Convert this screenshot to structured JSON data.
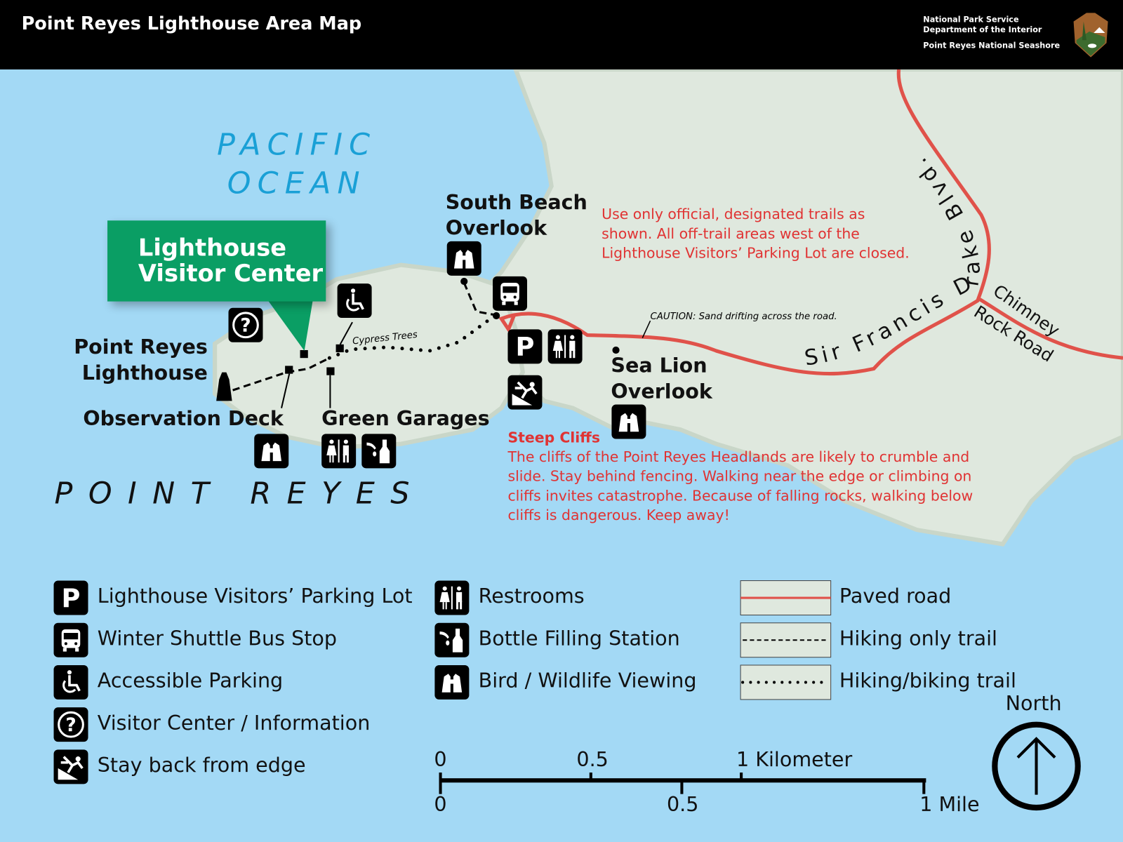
{
  "header": {
    "title": "Point Reyes Lighthouse Area Map",
    "agency_line1": "National Park Service",
    "agency_line2": "Department of the Interior",
    "park": "Point Reyes National Seashore",
    "logo_text": "NATIONAL PARK SERVICE"
  },
  "map": {
    "ocean_label_1": "PACIFIC",
    "ocean_label_2": "OCEAN",
    "point_label": "POINT REYES",
    "visitor_center_1": "Lighthouse",
    "visitor_center_2": "Visitor Center",
    "lighthouse_1": "Point Reyes",
    "lighthouse_2": "Lighthouse",
    "observation_deck": "Observation Deck",
    "green_garages": "Green Garages",
    "south_beach_1": "South Beach",
    "south_beach_2": "Overlook",
    "sea_lion_1": "Sea Lion",
    "sea_lion_2": "Overlook",
    "cypress": "Cypress Trees",
    "caution": "CAUTION: Sand drifting across the road.",
    "road_main": "Sir Francis Drake Blvd.",
    "road_chimney_1": "Chimney",
    "road_chimney_2": "Rock Road",
    "trail_notice": [
      "Use only official, designated trails as",
      "shown. All off-trail areas west of the",
      "Lighthouse Visitors’ Parking Lot are closed."
    ],
    "cliffs_title": "Steep Cliffs",
    "cliffs_text": [
      "The cliffs of the Point Reyes Headlands are likely to crumble and",
      "slide. Stay behind fencing. Walking near the edge or climbing on",
      "cliffs invites catastrophe. Because of falling rocks, walking below",
      "cliffs is dangerous. Keep away!"
    ],
    "colors": {
      "ocean": "#a3d9f5",
      "land": "#dfe8de",
      "road": "#e0524a",
      "visitor_center": "#0a9e64",
      "warning": "#e03333"
    }
  },
  "legend": {
    "col1": [
      {
        "icon": "parking-icon",
        "label": "Lighthouse Visitors’ Parking Lot"
      },
      {
        "icon": "bus-icon",
        "label": "Winter Shuttle Bus Stop"
      },
      {
        "icon": "wheelchair-icon",
        "label": "Accessible Parking"
      },
      {
        "icon": "info-icon",
        "label": "Visitor Center / Information"
      },
      {
        "icon": "cliff-edge-icon",
        "label": "Stay back from edge"
      }
    ],
    "col2": [
      {
        "icon": "restroom-icon",
        "label": "Restrooms"
      },
      {
        "icon": "bottle-icon",
        "label": "Bottle Filling Station"
      },
      {
        "icon": "binoculars-icon",
        "label": "Bird / Wildlife Viewing"
      }
    ],
    "col3": [
      {
        "line": "paved-road",
        "label": "Paved road"
      },
      {
        "line": "hiking-only-trail",
        "label": "Hiking only trail"
      },
      {
        "line": "hiking-biking-trail",
        "label": "Hiking/biking trail"
      }
    ]
  },
  "scale": {
    "km_ticks": [
      "0",
      "0.5",
      "1 Kilometer"
    ],
    "mile_ticks": [
      "0",
      "0.5",
      "1 Mile"
    ]
  },
  "north": "North"
}
